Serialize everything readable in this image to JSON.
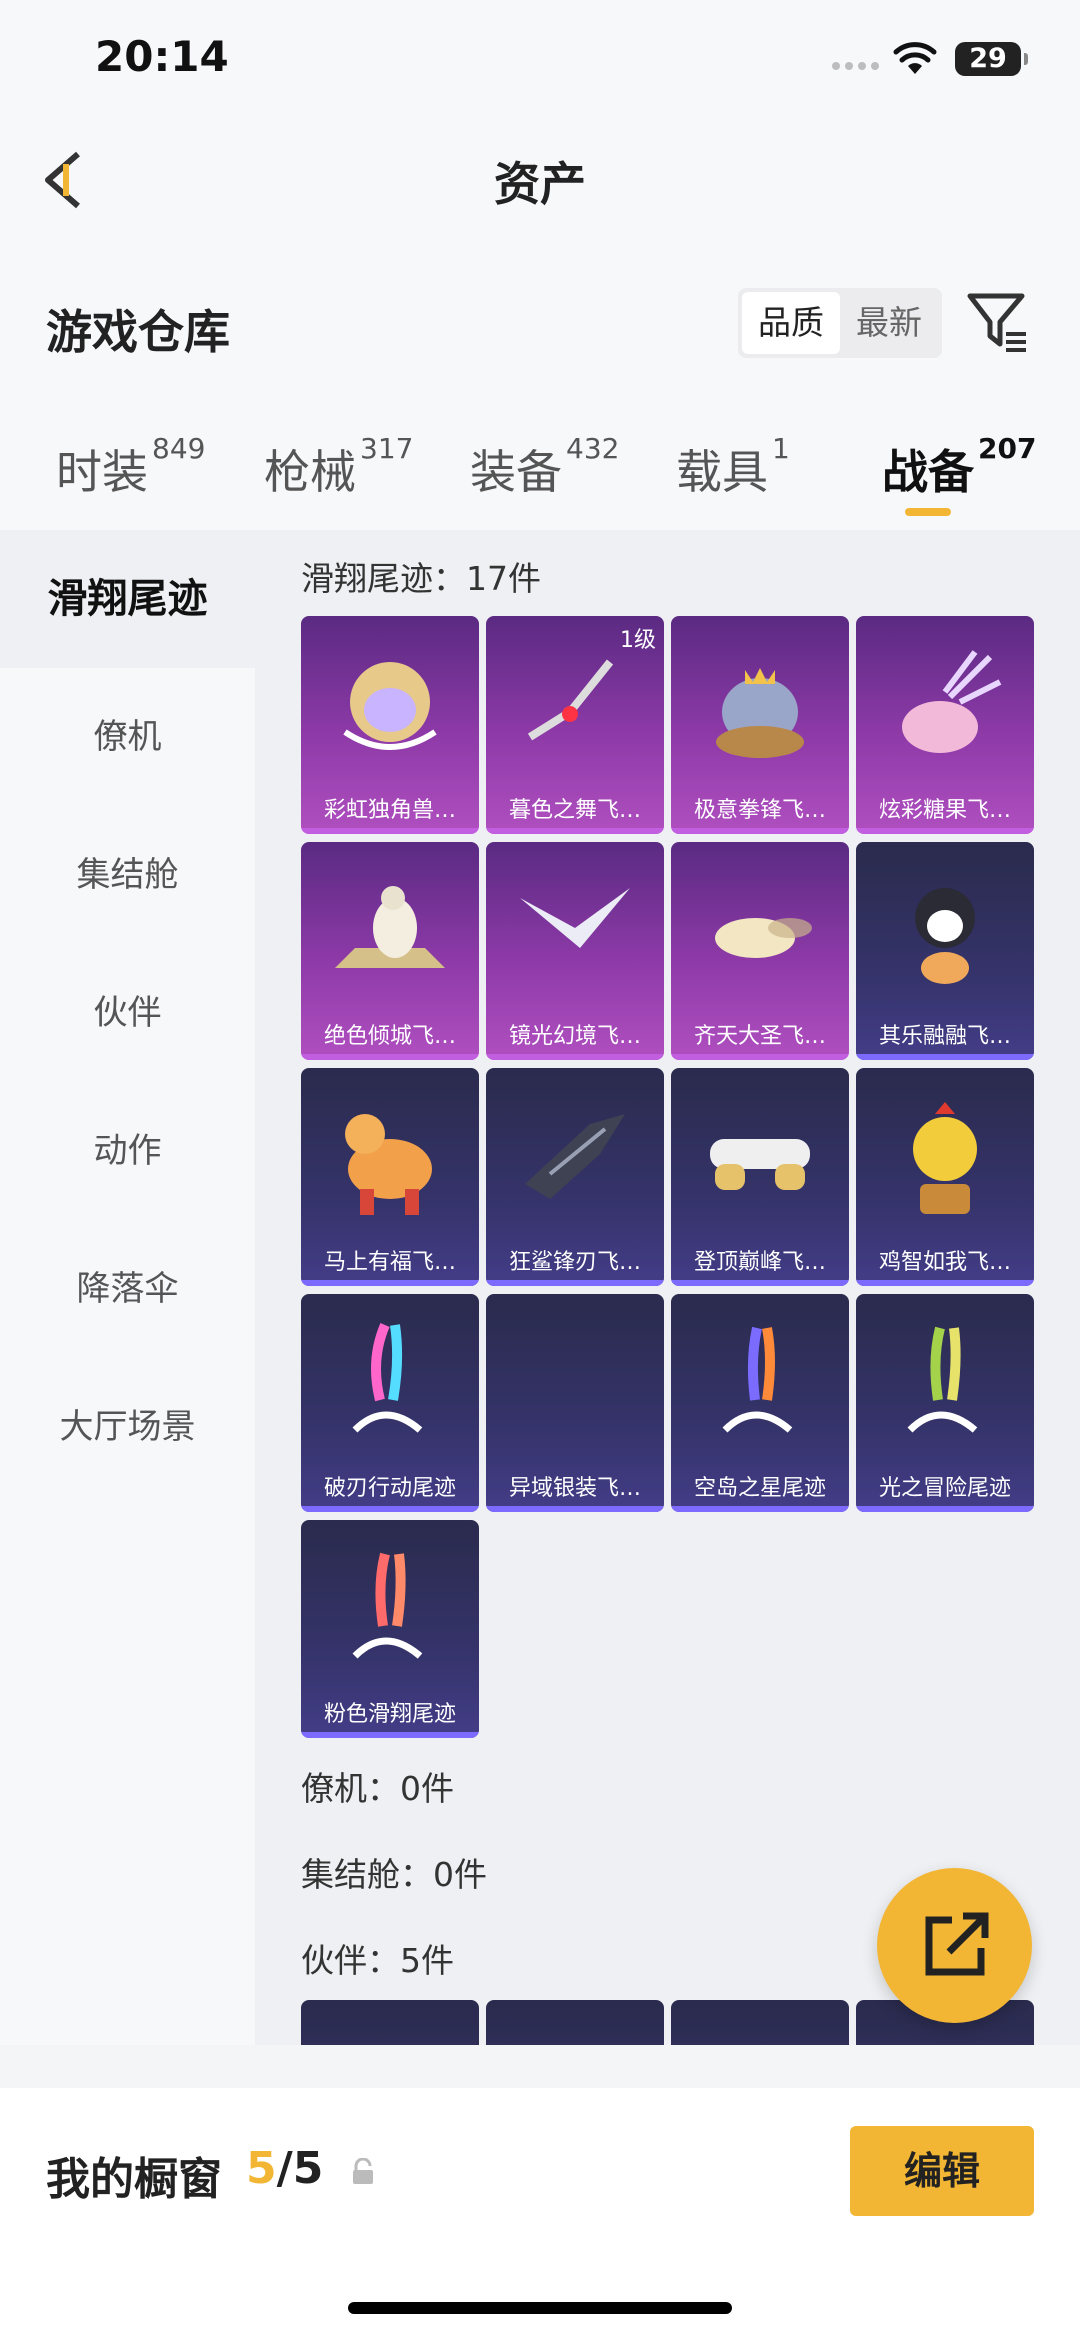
{
  "status": {
    "time": "20:14",
    "battery": "29"
  },
  "nav": {
    "title": "资产"
  },
  "warehouse": {
    "title": "游戏仓库",
    "sort_options": [
      "品质",
      "最新"
    ],
    "active_sort": "品质"
  },
  "tabs": [
    {
      "label": "时装",
      "count": "849"
    },
    {
      "label": "枪械",
      "count": "317"
    },
    {
      "label": "装备",
      "count": "432"
    },
    {
      "label": "载具",
      "count": "1"
    },
    {
      "label": "战备",
      "count": "207"
    }
  ],
  "sidebar": [
    "滑翔尾迹",
    "僚机",
    "集结舱",
    "伙伴",
    "动作",
    "降落伞",
    "大厅场景"
  ],
  "sections": {
    "trail_title": "滑翔尾迹：17件",
    "wingman_title": "僚机：0件",
    "pod_title": "集结舱：0件",
    "partner_title": "伙伴：5件"
  },
  "items": [
    {
      "name": "彩虹独角兽…",
      "badge": ""
    },
    {
      "name": "暮色之舞飞…",
      "badge": "1级"
    },
    {
      "name": "极意拳锋飞…",
      "badge": ""
    },
    {
      "name": "炫彩糖果飞…",
      "badge": ""
    },
    {
      "name": "绝色倾城飞…",
      "badge": ""
    },
    {
      "name": "镜光幻境飞…",
      "badge": ""
    },
    {
      "name": "齐天大圣飞…",
      "badge": ""
    },
    {
      "name": "其乐融融飞…",
      "badge": ""
    },
    {
      "name": "马上有福飞…",
      "badge": ""
    },
    {
      "name": "狂鲨锋刃飞…",
      "badge": ""
    },
    {
      "name": "登顶巅峰飞…",
      "badge": ""
    },
    {
      "name": "鸡智如我飞…",
      "badge": ""
    },
    {
      "name": "破刃行动尾迹",
      "badge": ""
    },
    {
      "name": "异域银装飞…",
      "badge": ""
    },
    {
      "name": "空岛之星尾迹",
      "badge": ""
    },
    {
      "name": "光之冒险尾迹",
      "badge": ""
    },
    {
      "name": "粉色滑翔尾迹",
      "badge": ""
    }
  ],
  "showcase": {
    "title": "我的橱窗",
    "current": "5",
    "total": "/5",
    "edit_label": "编辑"
  },
  "colors": {
    "accent": "#f2b634",
    "purple_card": "#8e3aa8",
    "blue_card": "#35336a"
  }
}
